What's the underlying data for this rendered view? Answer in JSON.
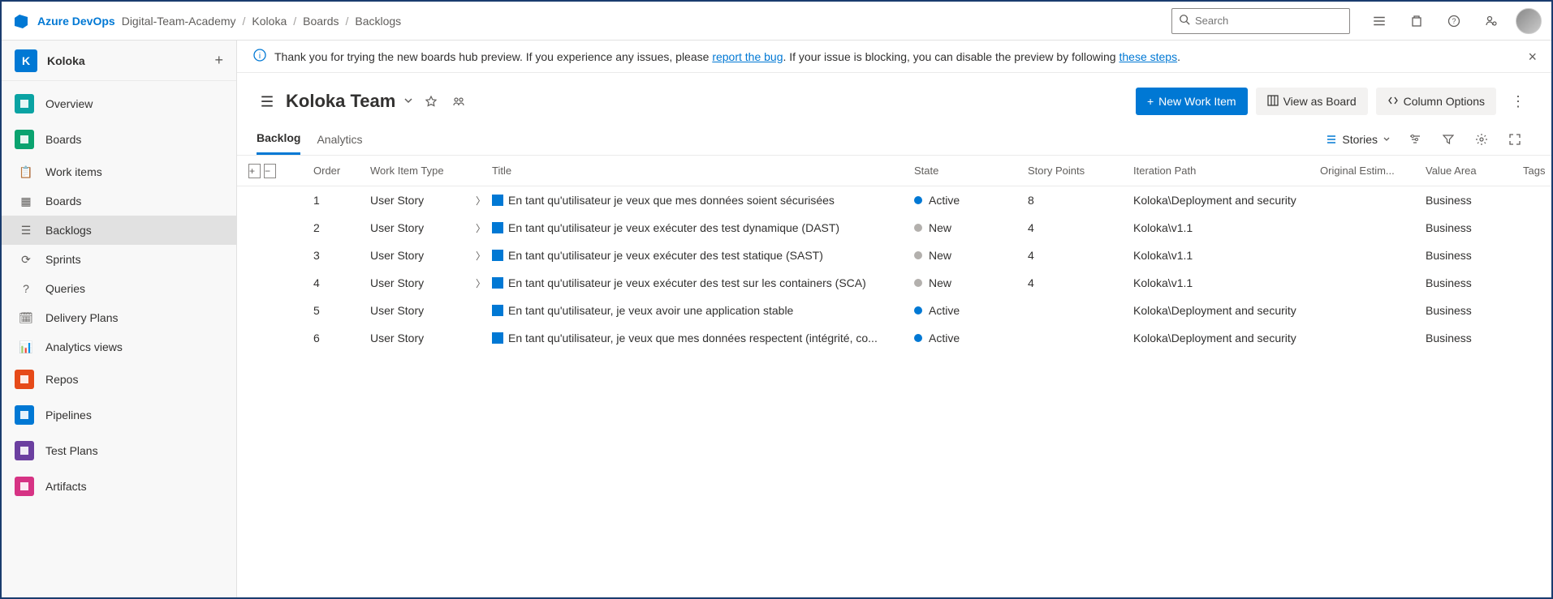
{
  "header": {
    "brand": "Azure DevOps",
    "breadcrumb": [
      "Digital-Team-Academy",
      "Koloka",
      "Boards",
      "Backlogs"
    ],
    "search_placeholder": "Search"
  },
  "sidebar": {
    "project_initial": "K",
    "project_name": "Koloka",
    "items": [
      {
        "label": "Overview",
        "tile_color": "#0aa3a3",
        "icon": "overview"
      },
      {
        "label": "Boards",
        "tile_color": "#0aa36f",
        "icon": "boards",
        "expanded": true,
        "subs": [
          {
            "label": "Work items"
          },
          {
            "label": "Boards"
          },
          {
            "label": "Backlogs",
            "active": true
          },
          {
            "label": "Sprints"
          },
          {
            "label": "Queries"
          },
          {
            "label": "Delivery Plans"
          },
          {
            "label": "Analytics views"
          }
        ]
      },
      {
        "label": "Repos",
        "tile_color": "#e64a19",
        "icon": "repos"
      },
      {
        "label": "Pipelines",
        "tile_color": "#0078d4",
        "icon": "pipelines"
      },
      {
        "label": "Test Plans",
        "tile_color": "#6b3fa0",
        "icon": "testplans"
      },
      {
        "label": "Artifacts",
        "tile_color": "#d63384",
        "icon": "artifacts"
      }
    ]
  },
  "banner": {
    "prefix": "Thank you for trying the new boards hub preview. If you experience any issues, please ",
    "link1": "report the bug",
    "middle": ". If your issue is blocking, you can disable the preview by following ",
    "link2": "these steps",
    "suffix": "."
  },
  "toolbar": {
    "team_name": "Koloka Team",
    "new_work_item": "New Work Item",
    "view_as_board": "View as Board",
    "column_options": "Column Options"
  },
  "tabs": {
    "items": [
      "Backlog",
      "Analytics"
    ],
    "active": "Backlog",
    "level_label": "Stories"
  },
  "grid": {
    "columns": [
      "Order",
      "Work Item Type",
      "Title",
      "State",
      "Story Points",
      "Iteration Path",
      "Original Estim...",
      "Value Area",
      "Tags"
    ],
    "rows": [
      {
        "order": "1",
        "type": "User Story",
        "chevron": true,
        "title": "En tant qu'utilisateur je veux que mes données soient sécurisées",
        "state": "Active",
        "points": "8",
        "iteration": "Koloka\\Deployment and security",
        "value_area": "Business"
      },
      {
        "order": "2",
        "type": "User Story",
        "chevron": true,
        "title": "En tant qu'utilisateur je veux exécuter des test dynamique (DAST)",
        "state": "New",
        "points": "4",
        "iteration": "Koloka\\v1.1",
        "value_area": "Business"
      },
      {
        "order": "3",
        "type": "User Story",
        "chevron": true,
        "title": "En tant qu'utilisateur je veux exécuter des test statique (SAST)",
        "state": "New",
        "points": "4",
        "iteration": "Koloka\\v1.1",
        "value_area": "Business"
      },
      {
        "order": "4",
        "type": "User Story",
        "chevron": true,
        "title": "En tant qu'utilisateur je veux exécuter des test sur les containers (SCA)",
        "state": "New",
        "points": "4",
        "iteration": "Koloka\\v1.1",
        "value_area": "Business"
      },
      {
        "order": "5",
        "type": "User Story",
        "chevron": false,
        "title": "En tant qu'utilisateur, je veux avoir une application stable",
        "state": "Active",
        "points": "",
        "iteration": "Koloka\\Deployment and security",
        "value_area": "Business"
      },
      {
        "order": "6",
        "type": "User Story",
        "chevron": false,
        "title": "En tant qu'utilisateur, je veux que mes données respectent (intégrité, co...",
        "state": "Active",
        "points": "",
        "iteration": "Koloka\\Deployment and security",
        "value_area": "Business"
      }
    ]
  }
}
